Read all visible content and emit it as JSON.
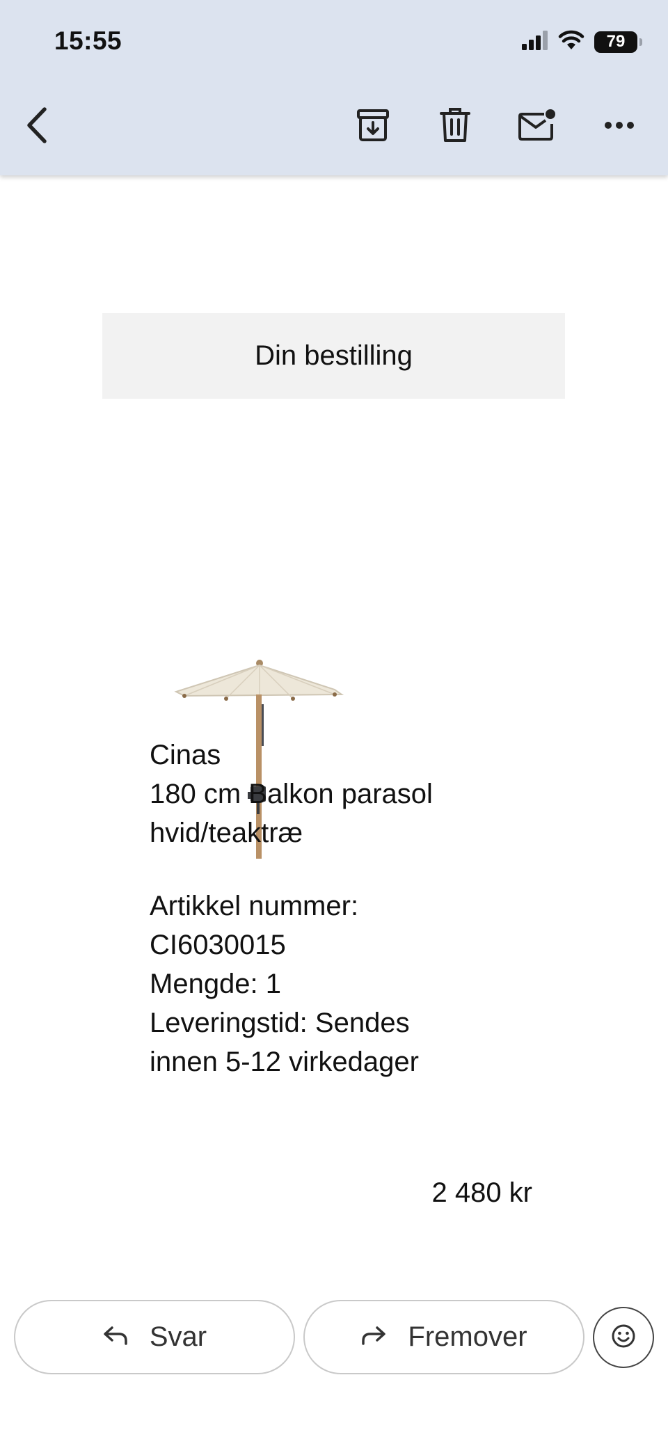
{
  "status_bar": {
    "time": "15:55",
    "battery_level": "79"
  },
  "toolbar": {
    "icons": [
      "back-arrow-icon",
      "archive-icon",
      "trash-icon",
      "mark-unread-icon",
      "more-options-icon"
    ]
  },
  "email": {
    "banner_title": "Din bestilling",
    "product": {
      "brand": "Cinas",
      "name": "180 cm Balkon parasol",
      "variant": "hvid/teaktræ",
      "article_label": "Artikkel nummer:",
      "article_number": "CI6030015",
      "quantity": "Mengde: 1",
      "delivery_line1": "Leveringstid: Sendes",
      "delivery_line2": "innen 5-12 virkedager",
      "price": "2 480 kr"
    }
  },
  "actions": {
    "reply_label": "Svar",
    "forward_label": "Fremover"
  },
  "colors": {
    "toolbar_bg": "#dce3ef",
    "banner_bg": "#f2f2f2",
    "button_border": "#c9c9c9"
  }
}
